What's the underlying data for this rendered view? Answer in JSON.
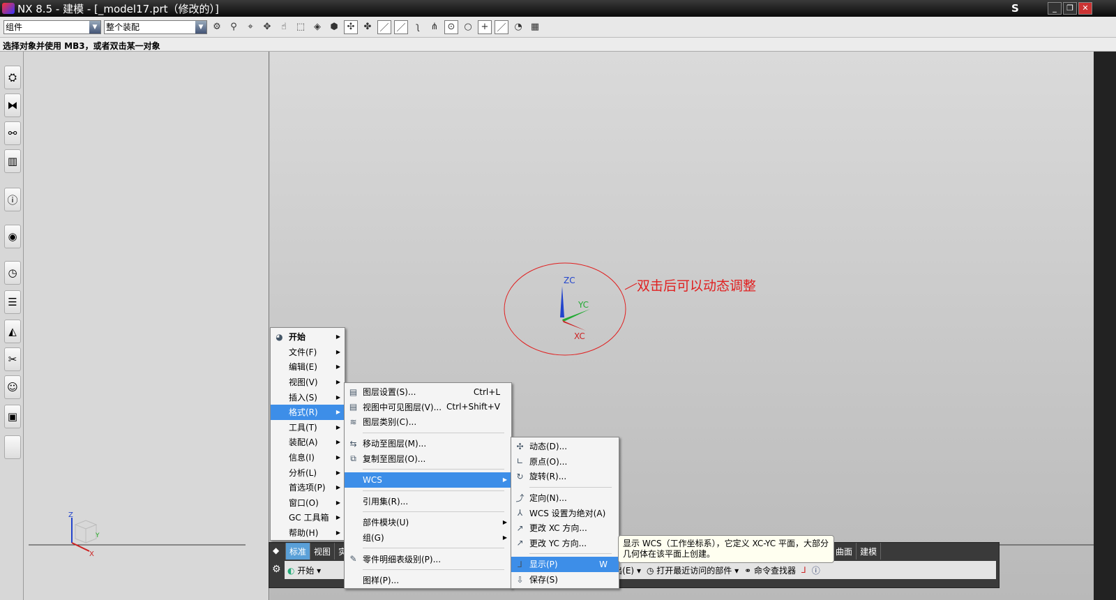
{
  "title": "NX 8.5 - 建模 - [_model17.prt（修改的）]",
  "title_right_letter": "S",
  "toolbar": {
    "filter_value": "组件",
    "scope_value": "整个装配"
  },
  "status_text": "选择对象并使用 MB3，或者双击某一对象",
  "main_menu": [
    {
      "label": "开始",
      "bold": true
    },
    {
      "label": "文件(F)"
    },
    {
      "label": "编辑(E)"
    },
    {
      "label": "视图(V)"
    },
    {
      "label": "插入(S)"
    },
    {
      "label": "格式(R)",
      "selected": true
    },
    {
      "label": "工具(T)"
    },
    {
      "label": "装配(A)"
    },
    {
      "label": "信息(I)"
    },
    {
      "label": "分析(L)"
    },
    {
      "label": "首选项(P)"
    },
    {
      "label": "窗口(O)"
    },
    {
      "label": "GC 工具箱"
    },
    {
      "label": "帮助(H)"
    }
  ],
  "format_menu": [
    {
      "label": "图层设置(S)...",
      "shortcut": "Ctrl+L"
    },
    {
      "label": "视图中可见图层(V)...",
      "shortcut": "Ctrl+Shift+V"
    },
    {
      "label": "图层类别(C)..."
    },
    {
      "label": "移动至图层(M)..."
    },
    {
      "label": "复制至图层(O)..."
    },
    {
      "label": "WCS"
    },
    {
      "label": "引用集(R)..."
    },
    {
      "label": "部件模块(U)"
    },
    {
      "label": "组(G)"
    },
    {
      "label": "零件明细表级别(P)..."
    },
    {
      "label": "图样(P)..."
    }
  ],
  "wcs_menu": [
    {
      "label": "动态(D)..."
    },
    {
      "label": "原点(O)..."
    },
    {
      "label": "旋转(R)..."
    },
    {
      "label": "定向(N)..."
    },
    {
      "label": "WCS 设置为绝对(A)"
    },
    {
      "label": "更改 XC 方向..."
    },
    {
      "label": "更改 YC 方向..."
    },
    {
      "label": "显示(P)",
      "shortcut": "W"
    },
    {
      "label": "保存(S)"
    }
  ],
  "tooltip": "显示 WCS（工作坐标系），它定义 XC-YC 平面，大部分几何体在该平面上创建。",
  "bottom_tabs": [
    "标准",
    "视图",
    "实",
    "曲面",
    "建模"
  ],
  "bottom_toolbar": {
    "start": "开始",
    "export": "导出(E)",
    "recent": "打开最近访问的部件",
    "finder": "命令查找器"
  },
  "annotation": "双击后可以动态调整",
  "axes": {
    "z": "ZC",
    "y": "YC",
    "x": "XC",
    "small_z": "Z",
    "small_y": "Y",
    "small_x": "X"
  },
  "colors": {
    "accent": "#3d8ee8",
    "annotation": "#e02020"
  }
}
